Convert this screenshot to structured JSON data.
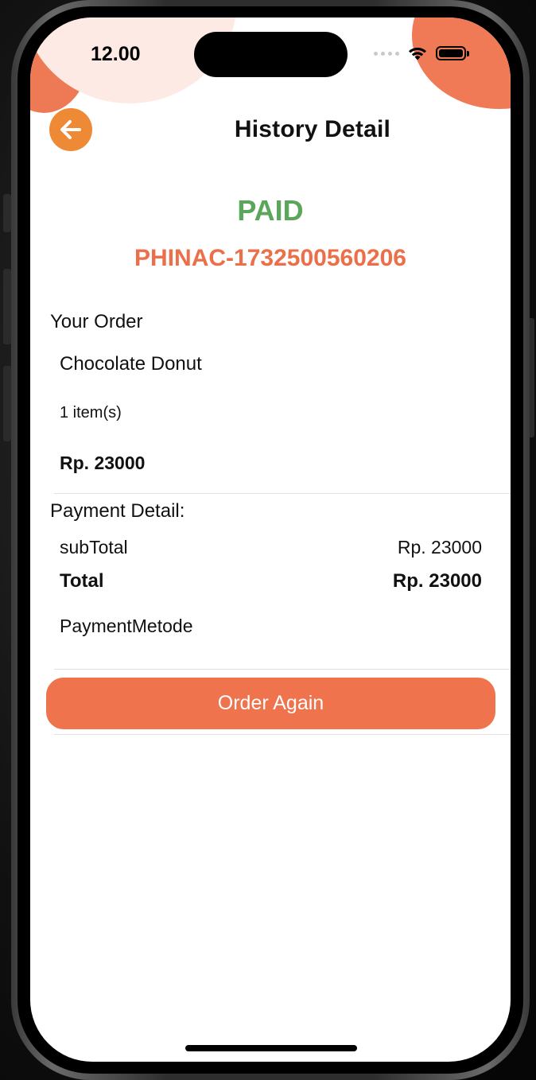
{
  "status_bar": {
    "time": "12.00"
  },
  "header": {
    "title": "History Detail"
  },
  "order": {
    "status": "PAID",
    "status_color": "#5aa65a",
    "id": "PHINAC-1732500560206",
    "id_color": "#ec6f4a"
  },
  "your_order": {
    "label": "Your Order",
    "items": [
      {
        "name": "Chocolate Donut",
        "quantity": "1 item(s)",
        "price": "Rp. 23000"
      }
    ]
  },
  "payment": {
    "label": "Payment Detail:",
    "subtotal_label": "subTotal",
    "subtotal_value": "Rp. 23000",
    "total_label": "Total",
    "total_value": "Rp. 23000",
    "method_label": "PaymentMetode"
  },
  "actions": {
    "order_again_label": "Order Again",
    "accent_color": "#ef734d"
  },
  "icons": {
    "back": "arrow-left-icon",
    "wifi": "wifi-icon",
    "battery": "battery-icon",
    "signal": "signal-icon"
  }
}
